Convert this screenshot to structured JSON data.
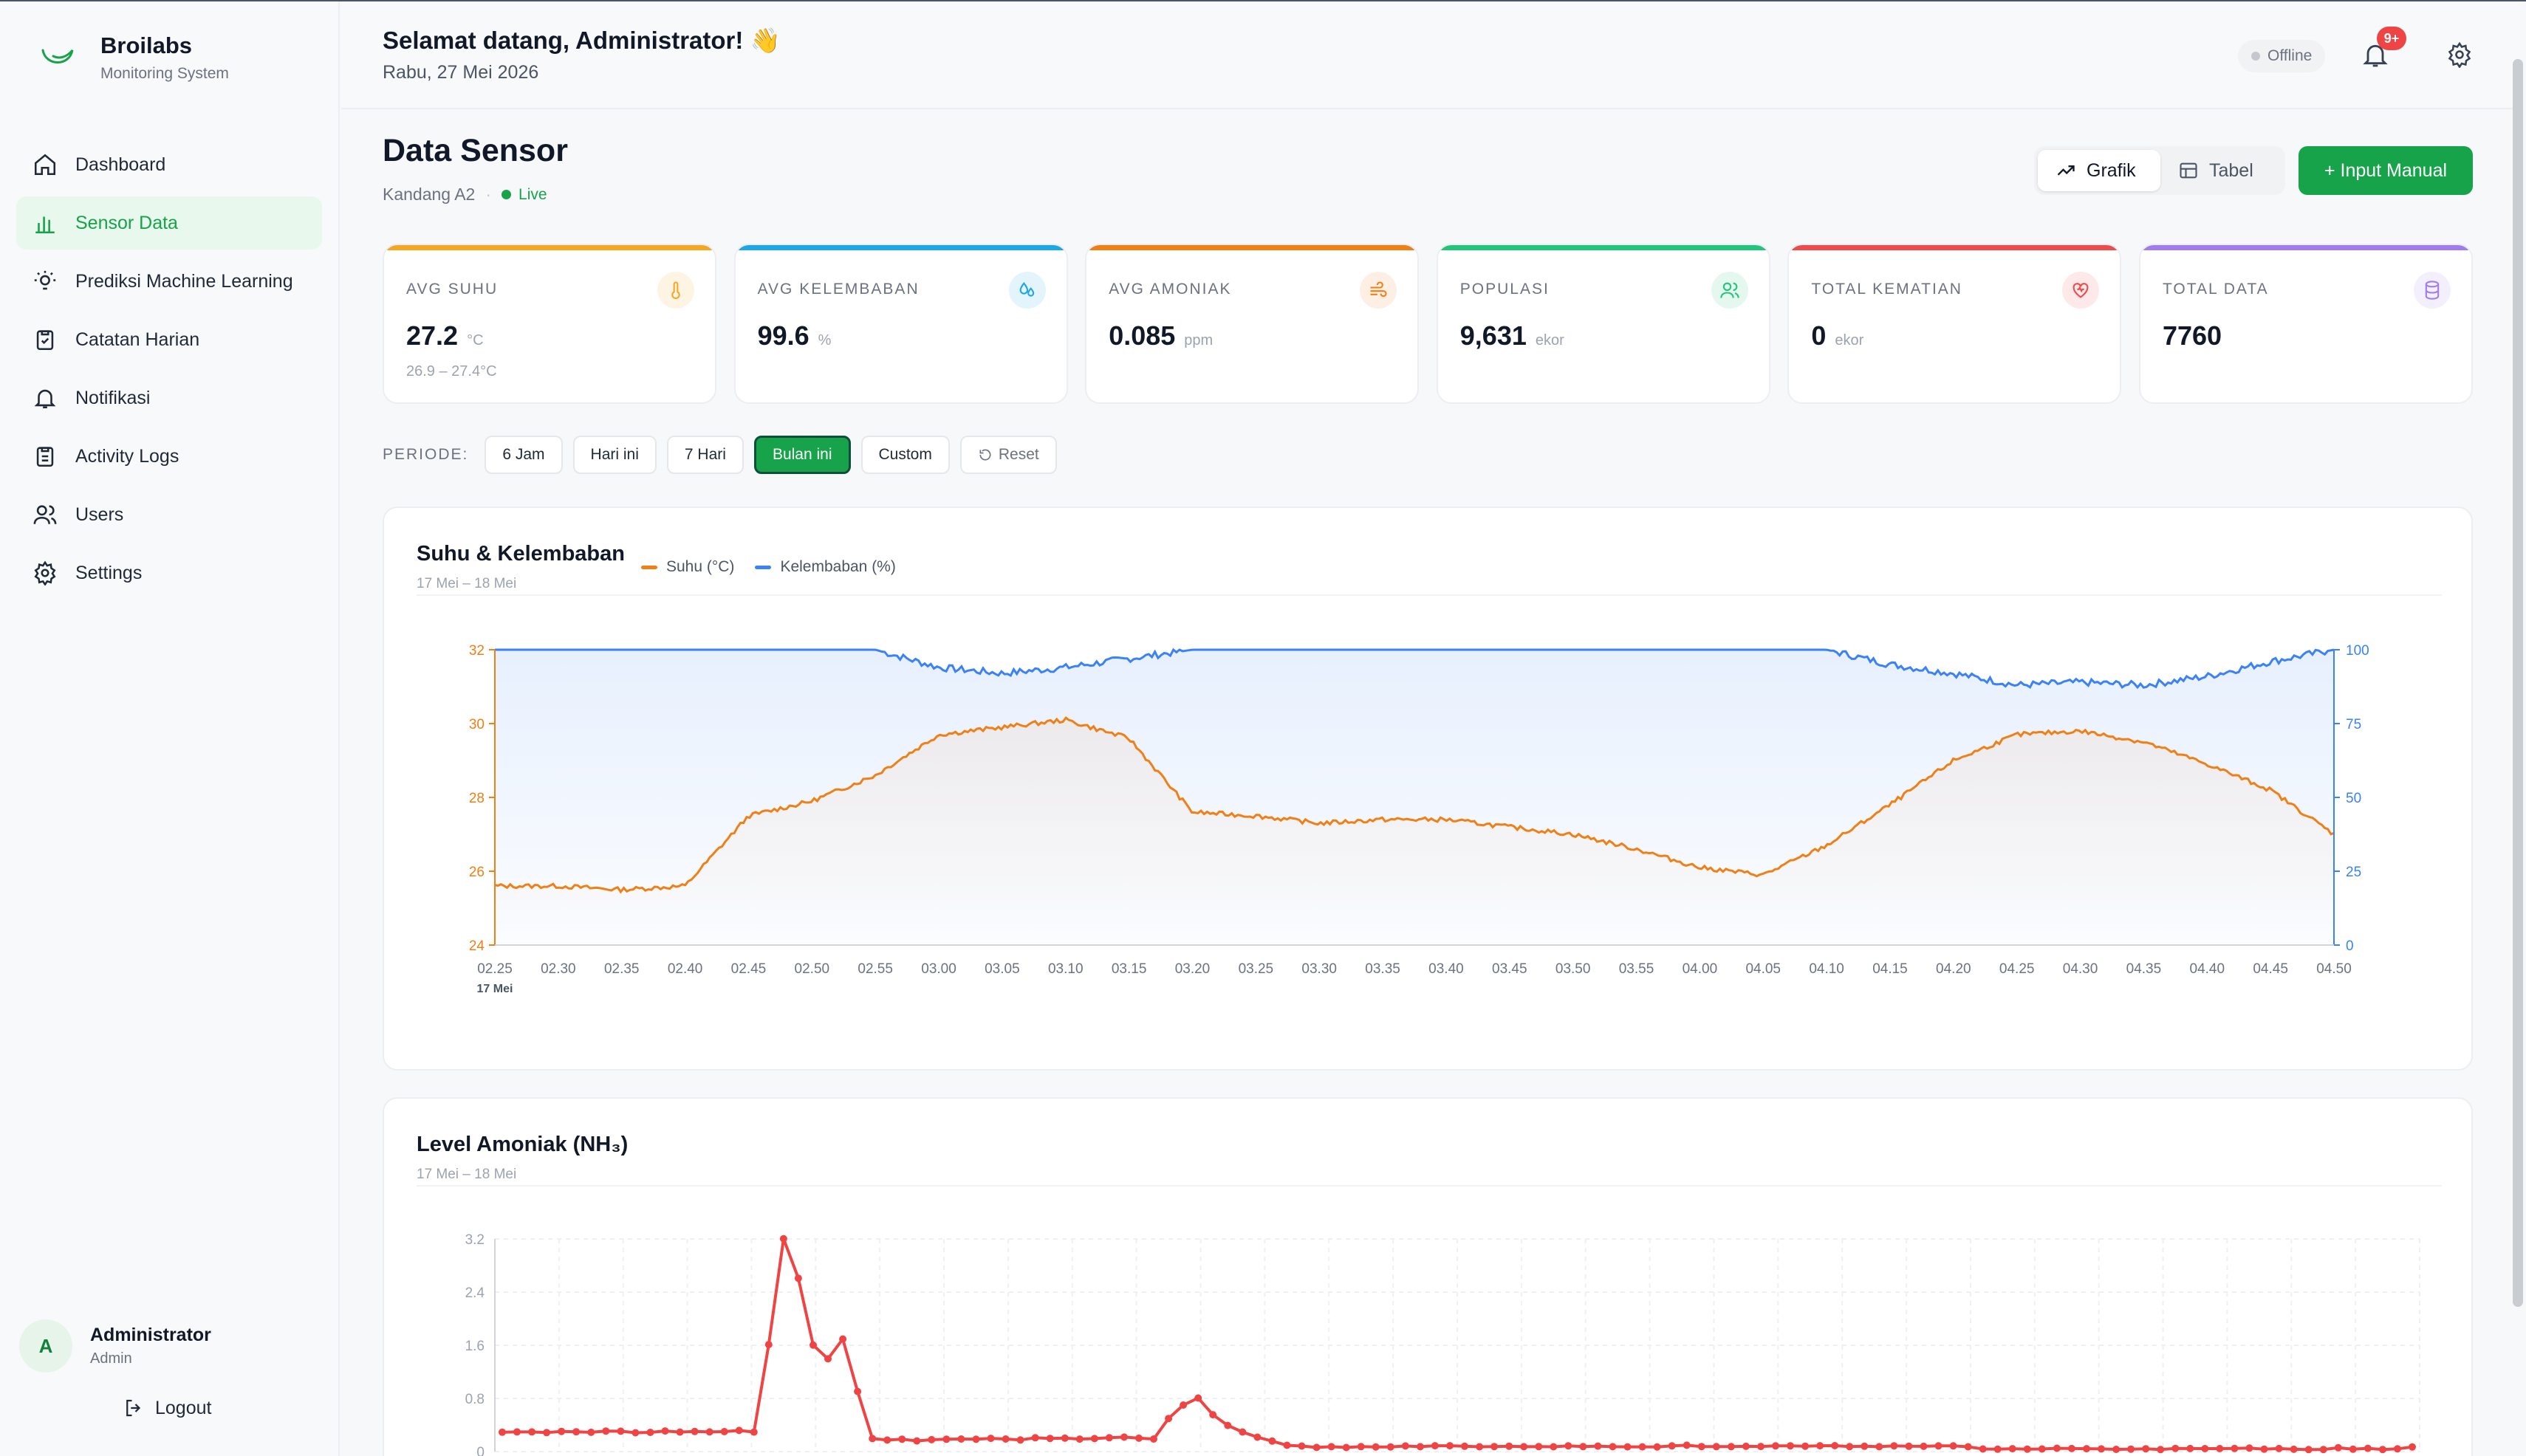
{
  "brand": {
    "name": "Broilabs",
    "subtitle": "Monitoring System"
  },
  "sidebar": {
    "items": [
      {
        "label": "Dashboard",
        "icon": "home-icon",
        "active": false
      },
      {
        "label": "Sensor Data",
        "icon": "bar-chart-icon",
        "active": true
      },
      {
        "label": "Prediksi Machine Learning",
        "icon": "lightbulb-icon",
        "active": false
      },
      {
        "label": "Catatan Harian",
        "icon": "clipboard-icon",
        "active": false
      },
      {
        "label": "Notifikasi",
        "icon": "bell-icon",
        "active": false
      },
      {
        "label": "Activity Logs",
        "icon": "clipboard-list-icon",
        "active": false
      },
      {
        "label": "Users",
        "icon": "users-icon",
        "active": false
      },
      {
        "label": "Settings",
        "icon": "gear-icon",
        "active": false
      }
    ],
    "user": {
      "initial": "A",
      "name": "Administrator",
      "role": "Admin"
    },
    "logout_label": "Logout"
  },
  "header": {
    "greeting": "Selamat datang, Administrator! 👋",
    "date": "Rabu, 27 Mei 2026",
    "status": "Offline",
    "notif_badge": "9+"
  },
  "page": {
    "title": "Data Sensor",
    "location": "Kandang A2",
    "live_label": "Live",
    "view_toggle": {
      "chart": "Grafik",
      "table": "Tabel"
    },
    "input_button": "+ Input Manual"
  },
  "stats": [
    {
      "label": "AVG SUHU",
      "value": "27.2",
      "unit": "°C",
      "range": "26.9 – 27.4°C",
      "color": "#f5a623",
      "icon": "thermometer-icon"
    },
    {
      "label": "AVG KELEMBABAN",
      "value": "99.6",
      "unit": "%",
      "range": "",
      "color": "#1ea7e8",
      "icon": "droplets-icon"
    },
    {
      "label": "AVG AMONIAK",
      "value": "0.085",
      "unit": "ppm",
      "range": "",
      "color": "#f07f16",
      "icon": "wind-icon"
    },
    {
      "label": "POPULASI",
      "value": "9,631",
      "unit": "ekor",
      "range": "",
      "color": "#22c579",
      "icon": "users-icon"
    },
    {
      "label": "TOTAL KEMATIAN",
      "value": "0",
      "unit": "ekor",
      "range": "",
      "color": "#ef4b4b",
      "icon": "heart-icon"
    },
    {
      "label": "TOTAL DATA",
      "value": "7760",
      "unit": "",
      "range": "",
      "color": "#a07cf0",
      "icon": "database-icon"
    }
  ],
  "period": {
    "label": "PERIODE:",
    "options": [
      "6 Jam",
      "Hari ini",
      "7 Hari",
      "Bulan ini",
      "Custom"
    ],
    "selected": "Bulan ini",
    "reset_label": "Reset"
  },
  "charts": {
    "temp_humidity": {
      "title": "Suhu & Kelembaban",
      "subtitle": "17 Mei – 18 Mei",
      "legend": [
        "Suhu (°C)",
        "Kelembaban (%)"
      ],
      "date_label": "17 Mei"
    },
    "ammonia": {
      "title": "Level Amoniak (NH₃)",
      "subtitle": "17 Mei – 18 Mei"
    }
  },
  "chart_data": [
    {
      "type": "line",
      "title": "Suhu & Kelembaban",
      "subtitle": "17 Mei – 18 Mei",
      "x": [
        "02.25",
        "02.30",
        "02.35",
        "02.40",
        "02.45",
        "02.50",
        "02.55",
        "03.00",
        "03.05",
        "03.10",
        "03.15",
        "03.20",
        "03.25",
        "03.30",
        "03.35",
        "03.40",
        "03.45",
        "03.50",
        "03.55",
        "04.00",
        "04.05",
        "04.10",
        "04.15",
        "04.20",
        "04.25",
        "04.30",
        "04.35",
        "04.40",
        "04.45",
        "04.50"
      ],
      "series": [
        {
          "name": "Suhu (°C)",
          "axis": "left",
          "color": "#f07f16",
          "values": [
            25.6,
            25.6,
            25.5,
            25.6,
            27.5,
            27.9,
            28.6,
            29.7,
            29.9,
            30.1,
            29.6,
            27.6,
            27.5,
            27.3,
            27.4,
            27.4,
            27.2,
            27.0,
            26.6,
            26.1,
            25.9,
            26.7,
            27.8,
            29.0,
            29.7,
            29.8,
            29.5,
            28.9,
            28.2,
            27.0
          ]
        },
        {
          "name": "Kelembaban (%)",
          "axis": "right",
          "color": "#3b82f6",
          "values": [
            100,
            100,
            100,
            100,
            100,
            100,
            100,
            94,
            92,
            94,
            97,
            100,
            100,
            100,
            100,
            100,
            100,
            100,
            100,
            100,
            100,
            100,
            95,
            92,
            88,
            89,
            88,
            91,
            96,
            100
          ]
        }
      ],
      "ylim_left": [
        24,
        32
      ],
      "yticks_left": [
        24,
        26,
        28,
        30,
        32
      ],
      "ylim_right": [
        0,
        100
      ],
      "yticks_right": [
        0,
        25,
        50,
        75,
        100
      ],
      "legend": "top-left"
    },
    {
      "type": "line",
      "title": "Level Amoniak (NH₃)",
      "subtitle": "17 Mei – 18 Mei",
      "series": [
        {
          "name": "",
          "color": "#ef4444",
          "values": [
            0.3,
            0.3,
            0.3,
            0.29,
            0.3,
            0.3,
            0.29,
            0.3,
            0.3,
            0.29,
            0.29,
            0.3,
            0.29,
            0.3,
            0.3,
            0.3,
            0.31,
            0.3,
            1.6,
            3.2,
            2.6,
            1.6,
            1.4,
            1.7,
            0.9,
            0.2,
            0.18,
            0.18,
            0.17,
            0.18,
            0.19,
            0.18,
            0.19,
            0.2,
            0.19,
            0.18,
            0.2,
            0.19,
            0.2,
            0.18,
            0.19,
            0.2,
            0.21,
            0.2,
            0.19,
            0.5,
            0.7,
            0.8,
            0.55,
            0.4,
            0.3,
            0.22,
            0.15,
            0.1,
            0.08,
            0.07,
            0.08,
            0.07,
            0.08,
            0.07,
            0.08,
            0.08,
            0.07,
            0.08,
            0.08,
            0.09,
            0.08,
            0.08,
            0.09,
            0.08,
            0.08,
            0.08,
            0.09,
            0.08,
            0.08,
            0.08,
            0.07,
            0.08,
            0.08,
            0.08,
            0.09,
            0.08,
            0.08,
            0.08,
            0.08,
            0.08,
            0.08,
            0.08,
            0.08,
            0.08,
            0.08,
            0.08,
            0.09,
            0.08,
            0.08,
            0.08,
            0.07,
            0.08,
            0.08,
            0.07,
            0.04,
            0.04,
            0.04,
            0.04,
            0.04,
            0.05,
            0.04,
            0.04,
            0.04,
            0.04,
            0.04,
            0.05,
            0.04,
            0.04,
            0.04,
            0.04,
            0.04,
            0.04,
            0.05,
            0.04,
            0.04,
            0.04,
            0.04,
            0.04,
            0.05,
            0.04,
            0.04,
            0.04,
            0.04,
            0.06
          ]
        }
      ],
      "ylim": [
        0,
        3.2
      ],
      "yticks": [
        0,
        0.8,
        1.6,
        2.4,
        3.2
      ]
    }
  ]
}
